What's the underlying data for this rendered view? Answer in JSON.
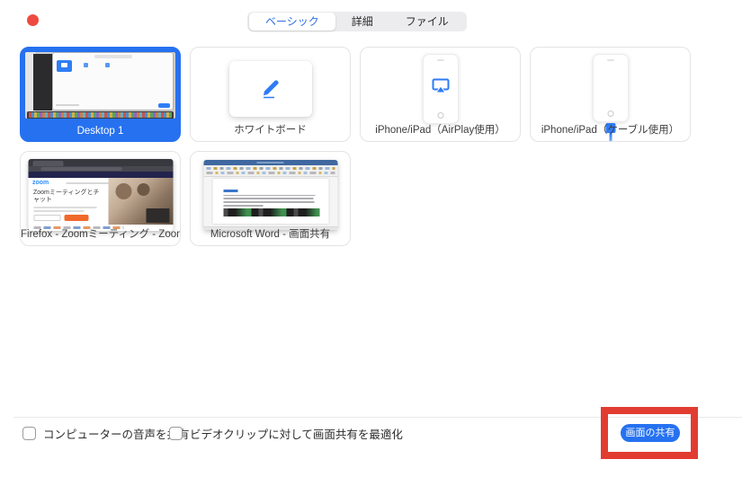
{
  "tabs": {
    "items": [
      {
        "label": "ベーシック",
        "active": true
      },
      {
        "label": "詳細",
        "active": false
      },
      {
        "label": "ファイル",
        "active": false
      }
    ]
  },
  "tiles": [
    {
      "label": "Desktop 1",
      "selected": true,
      "type": "screen-thumbnail"
    },
    {
      "label": "ホワイトボード",
      "selected": false,
      "icon": "pencil-icon"
    },
    {
      "label": "iPhone/iPad（AirPlay使用）",
      "selected": false,
      "icon": "airplay-icon"
    },
    {
      "label": "iPhone/iPad（ケーブル使用）",
      "selected": false,
      "icon": "cable-icon"
    },
    {
      "label": "Firefox - Zoomミーティング - Zoom...",
      "selected": false,
      "thumbnail_logo": "zoom",
      "thumbnail_heading": "Zoomミーティングとチャット"
    },
    {
      "label": "Microsoft Word - 画面共有",
      "selected": false
    }
  ],
  "footer": {
    "checkboxes": [
      {
        "label": "コンピューターの音声を共有",
        "checked": false
      },
      {
        "label": "ビデオクリップに対して画面共有を最適化",
        "checked": false
      }
    ],
    "share_button_label": "画面の共有"
  },
  "colors": {
    "accent_blue": "#2671f0",
    "tab_active_text": "#2e6de5",
    "annotation_red": "#e23c31",
    "close_dot_red": "#ee4b40"
  }
}
